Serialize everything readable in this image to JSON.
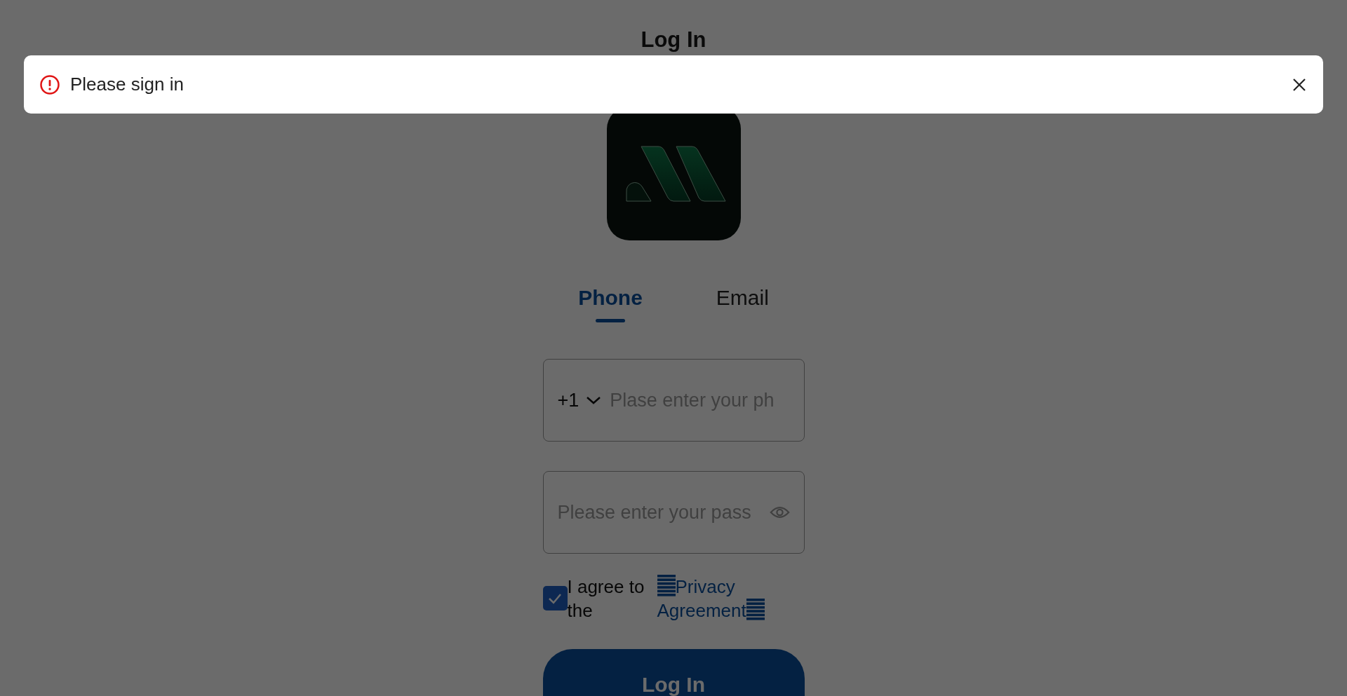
{
  "page_title": "Log In",
  "toast": {
    "kind": "error",
    "message": "Please sign in"
  },
  "tabs": [
    {
      "label": "Phone",
      "selected": true
    },
    {
      "label": "Email",
      "selected": false
    }
  ],
  "phone_field": {
    "country_code": "+1",
    "placeholder": "Plase enter your ph"
  },
  "password_field": {
    "placeholder": "Please enter your pass"
  },
  "agreement": {
    "checked": true,
    "text": "I agree to the",
    "link": "Privacy Agreement"
  },
  "login_button": {
    "label": "Log In"
  }
}
